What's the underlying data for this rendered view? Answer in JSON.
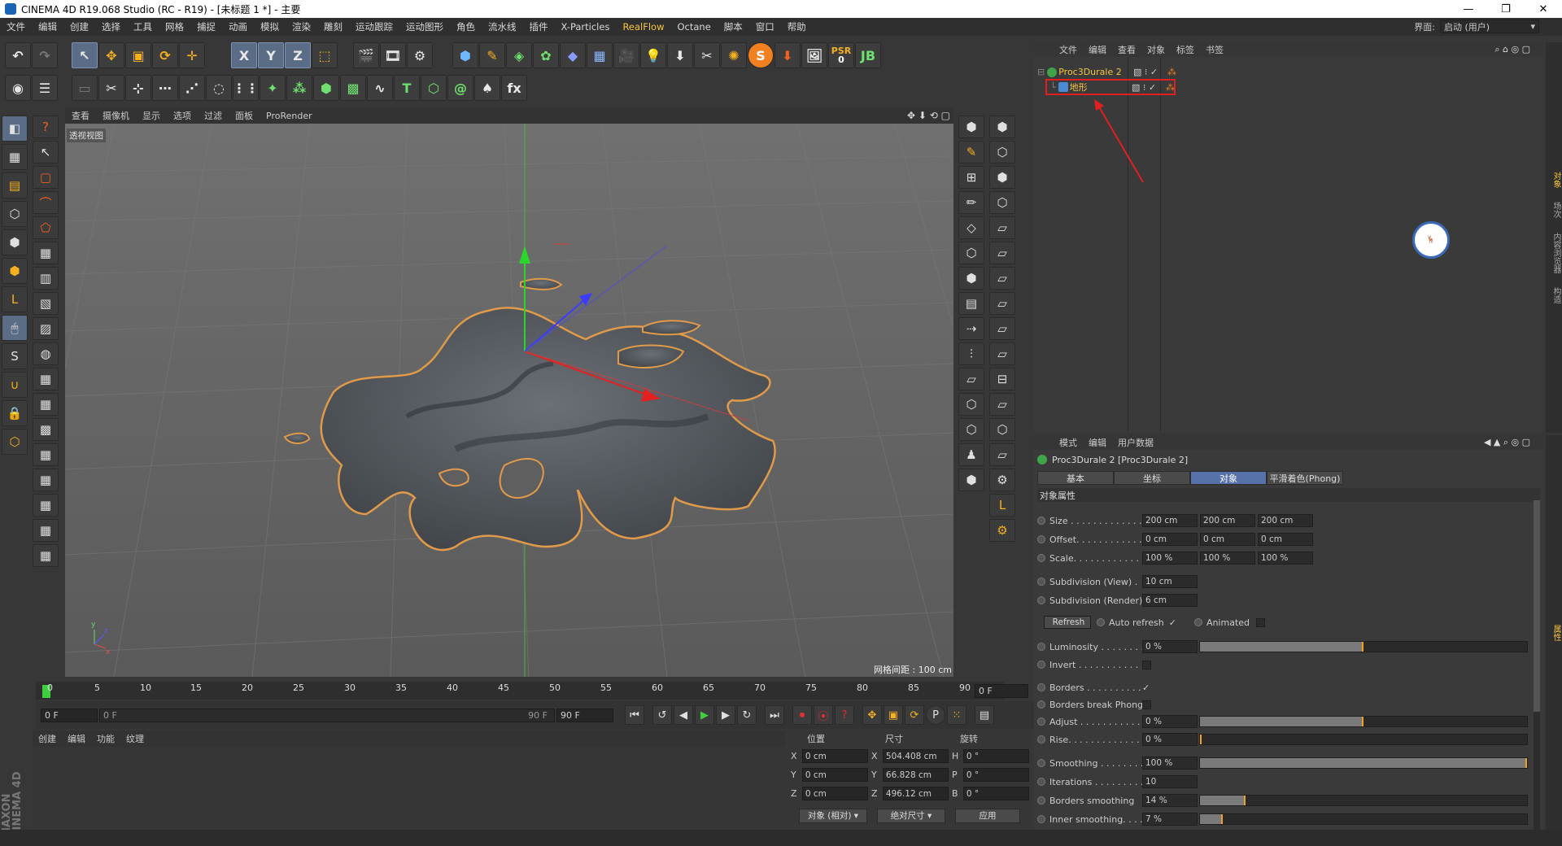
{
  "title_bar": {
    "title": "CINEMA 4D R19.068 Studio (RC - R19) - [未标题 1 *] - 主要"
  },
  "menu": {
    "items": [
      "文件",
      "编辑",
      "创建",
      "选择",
      "工具",
      "网格",
      "捕捉",
      "动画",
      "模拟",
      "渲染",
      "雕刻",
      "运动跟踪",
      "运动图形",
      "角色",
      "流水线",
      "插件",
      "X-Particles",
      "RealFlow",
      "Octane",
      "脚本",
      "窗口",
      "帮助"
    ],
    "highlight": "RealFlow",
    "layout_label": "界面:",
    "layout_value": "启动 (用户)"
  },
  "toolbar": {
    "axis": [
      "X",
      "Y",
      "Z"
    ],
    "psr_label": "PSR",
    "psr_value": "0"
  },
  "viewport": {
    "menu": [
      "查看",
      "摄像机",
      "显示",
      "选项",
      "过滤",
      "面板",
      "ProRender"
    ],
    "label": "透视视图",
    "grid_spacing": "网格间距 : 100 cm"
  },
  "timeline": {
    "ticks": [
      "0",
      "5",
      "10",
      "15",
      "20",
      "25",
      "30",
      "35",
      "40",
      "45",
      "50",
      "55",
      "60",
      "65",
      "70",
      "75",
      "80",
      "85",
      "90"
    ],
    "current_frame": "0 F",
    "start": "0 F",
    "range_start": "0 F",
    "range_end": "90 F",
    "end": "90 F"
  },
  "material_menu": [
    "创建",
    "编辑",
    "功能",
    "纹理"
  ],
  "coords": {
    "headers": [
      "位置",
      "尺寸",
      "旋转"
    ],
    "rows": [
      {
        "axis": "X",
        "pos": "0 cm",
        "size_axis": "X",
        "size": "504.408 cm",
        "rot_axis": "H",
        "rot": "0 °"
      },
      {
        "axis": "Y",
        "pos": "0 cm",
        "size_axis": "Y",
        "size": "66.828 cm",
        "rot_axis": "P",
        "rot": "0 °"
      },
      {
        "axis": "Z",
        "pos": "0 cm",
        "size_axis": "Z",
        "size": "496.12 cm",
        "rot_axis": "B",
        "rot": "0 °"
      }
    ],
    "mode_a": "对象 (相对)",
    "mode_b": "绝对尺寸",
    "apply": "应用"
  },
  "object_manager": {
    "menu": [
      "文件",
      "编辑",
      "查看",
      "对象",
      "标签",
      "书签"
    ],
    "objects": [
      {
        "name": "Proc3Durale 2"
      },
      {
        "name": "地形"
      }
    ]
  },
  "attributes": {
    "menu": [
      "模式",
      "编辑",
      "用户数据"
    ],
    "header": "Proc3Durale 2 [Proc3Durale 2]",
    "tabs": [
      "基本",
      "坐标",
      "对象",
      "平滑着色(Phong)"
    ],
    "active_tab": "对象",
    "section": "对象属性",
    "size": {
      "label": "Size . . . . . . . . . . . . .",
      "v": [
        "200 cm",
        "200 cm",
        "200 cm"
      ]
    },
    "offset": {
      "label": "Offset. . . . . . . . . . . .",
      "v": [
        "0 cm",
        "0 cm",
        "0 cm"
      ]
    },
    "scale": {
      "label": "Scale. . . . . . . . . . . . .",
      "v": [
        "100 %",
        "100 %",
        "100 %"
      ]
    },
    "subdiv_view": {
      "label": "Subdivision (View) .",
      "v": "10 cm"
    },
    "subdiv_render": {
      "label": "Subdivision (Render)",
      "v": "6 cm"
    },
    "refresh": "Refresh",
    "auto_refresh": "Auto refresh",
    "animated": "Animated",
    "luminosity": {
      "label": "Luminosity . . . . . . . .",
      "v": "0 %",
      "fill": 0.5
    },
    "invert": {
      "label": "Invert . . . . . . . . . . . ."
    },
    "borders": {
      "label": "Borders . . . . . . . . . . ."
    },
    "borders_phong": {
      "label": "Borders break Phong"
    },
    "adjust": {
      "label": "Adjust . . . . . . . . . . . .",
      "v": "0 %",
      "fill": 0.5
    },
    "rise": {
      "label": "Rise. . . . . . . . . . . . . .",
      "v": "0 %",
      "fill": 0.0
    },
    "smoothing": {
      "label": "Smoothing . . . . . . . .",
      "v": "100 %",
      "fill": 1.0
    },
    "iterations": {
      "label": "Iterations . . . . . . . . .",
      "v": "10"
    },
    "borders_smoothing": {
      "label": "Borders smoothing",
      "v": "14 %",
      "fill": 0.14
    },
    "inner_smoothing": {
      "label": "Inner smoothing. . . .",
      "v": "7 %",
      "fill": 0.07
    }
  },
  "side_tabs": [
    "对象",
    "场次",
    "内容浏览器",
    "构造"
  ],
  "side_tabs_attr": [
    "属性"
  ],
  "colors": {
    "accent": "#5772a8",
    "orange": "#f0a020",
    "highlight": "#f5c542"
  }
}
